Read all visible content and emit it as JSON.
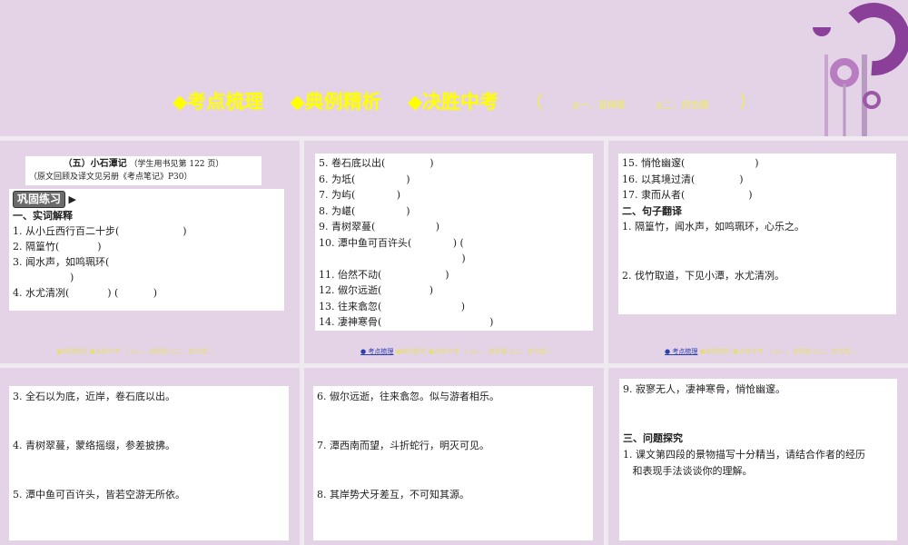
{
  "nav": {
    "items": [
      "◆考点梳理",
      "◆典例精析",
      "◆决胜中考"
    ],
    "open": "（",
    "sub1": "◎一、选择题",
    "sub2": "◎二、综合题",
    "close": "）"
  },
  "s1": {
    "title": "（五）小石潭记",
    "ref": "（学生用书见第 122 页）",
    "note": "（原文回顾及译文见另册《考点笔记》P30）",
    "badge": "巩固练习",
    "section": "一、实词解释",
    "lines": [
      "1. 从小丘西行百二十步(                    )",
      "2. 隔篁竹(            )",
      "3. 闻水声，如鸣珮环(",
      "                  )",
      "4. 水尤清冽(            ) (           )"
    ]
  },
  "s2": {
    "lines": [
      "5. 卷石底以出(              )",
      "6. 为坻(                )",
      "7. 为屿(             )",
      "8. 为嵁(                )",
      "9. 青树翠蔓(                   )",
      "10. 潭中鱼可百许头(             ) (",
      "                                             )",
      "11. 佁然不动(                    )",
      "12. 俶尔远逝(               )",
      "13. 往来翕忽(                         )",
      "14. 凄神寒骨(                                  )"
    ]
  },
  "s3": {
    "lines": [
      "15. 悄怆幽邃(                      )",
      "16. 以其境过清(              )",
      "17. 隶而从者(                    )"
    ],
    "section": "二、句子翻译",
    "q1": "1. 隔篁竹，闻水声，如鸣珮环，心乐之。",
    "q2": "2. 伐竹取道，下见小潭，水尤清冽。"
  },
  "s4": {
    "q3": "3. 全石以为底，近岸，卷石底以出。",
    "q4": "4. 青树翠蔓，蒙络摇缀，参差披拂。",
    "q5": "5. 潭中鱼可百许头，皆若空游无所依。"
  },
  "s5": {
    "q6": "6. 俶尔远逝，往来翕忽。似与游者相乐。",
    "q7": "7. 潭西南而望，斗折蛇行，明灭可见。",
    "q8": "8. 其岸势犬牙差互，不可知其源。"
  },
  "s6": {
    "q9": "9. 寂寥无人，凄神寒骨，悄怆幽邃。",
    "section": "三、问题探究",
    "p1a": "1. 课文第四段的景物描写十分精当，请结合作者的经历",
    "p1b": "   和表现手法谈谈你的理解。"
  },
  "mini": {
    "a": "● 考点梳理",
    "b": "●典例精析  ●决胜中考  （ ◎一、选择题  ◎二、综合题 ）"
  }
}
